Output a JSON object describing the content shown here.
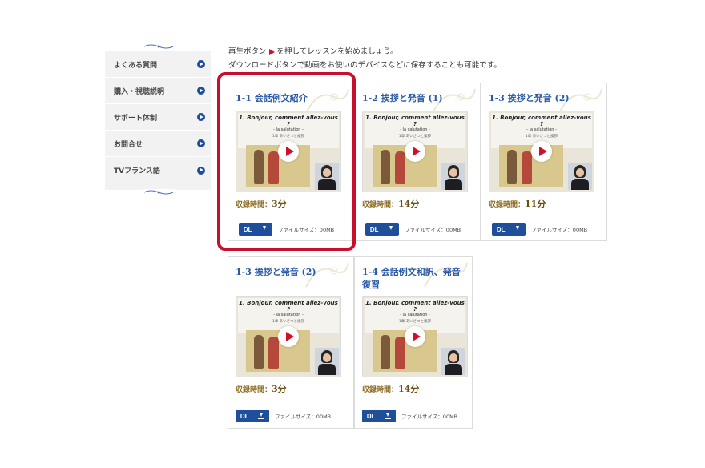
{
  "intro": {
    "line1_before": "再生ボタン",
    "line1_after": "を押してレッスンを始めましょう。",
    "line2": "ダウンロードボタンで動画をお使いのデバイスなどに保存することも可能です。"
  },
  "sidebar": {
    "items": [
      {
        "label": "よくある質問"
      },
      {
        "label": "購入・視聴説明"
      },
      {
        "label": "サポート体制"
      },
      {
        "label": "お問合せ"
      },
      {
        "label": "TVフランス語"
      }
    ]
  },
  "thumbnail": {
    "heading": "1. Bonjour, comment allez-vous ?",
    "sub": "- la salutation -",
    "sub2": "1章 あいさつと挨拶"
  },
  "cards": [
    {
      "title": "1-1 会話例文紹介",
      "duration_label": "収録時間：",
      "duration_value": "3分",
      "dl_label": "DL",
      "filesize": "ファイルサイズ：00MB"
    },
    {
      "title": "1-2 挨拶と発音 (1)",
      "duration_label": "収録時間：",
      "duration_value": "14分",
      "dl_label": "DL",
      "filesize": "ファイルサイズ：00MB"
    },
    {
      "title": "1-3 挨拶と発音 (2)",
      "duration_label": "収録時間：",
      "duration_value": "11分",
      "dl_label": "DL",
      "filesize": "ファイルサイズ：00MB"
    },
    {
      "title": "1-3 挨拶と発音 (2)",
      "duration_label": "収録時間：",
      "duration_value": "3分",
      "dl_label": "DL",
      "filesize": "ファイルサイズ：00MB"
    },
    {
      "title": "1-4 会話例文和訳、発音復習",
      "duration_label": "収録時間：",
      "duration_value": "14分",
      "dl_label": "DL",
      "filesize": "ファイルサイズ：00MB"
    }
  ],
  "colors": {
    "accent": "#1f4f9a",
    "play": "#d0102a",
    "highlight": "#c8102e",
    "title": "#2a5aa6"
  }
}
